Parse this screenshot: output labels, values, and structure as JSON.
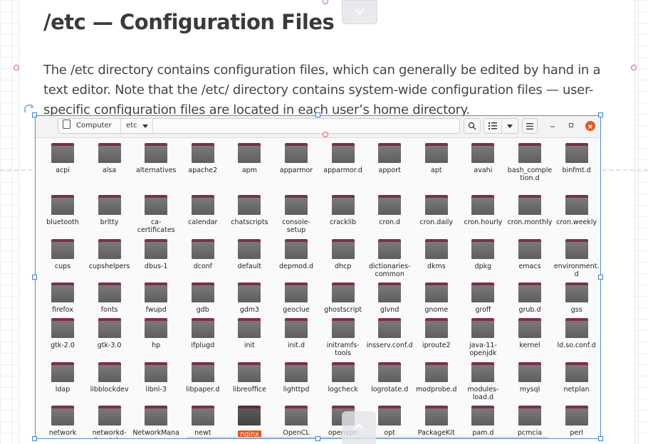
{
  "page": {
    "title": "/etc — Configuration Files",
    "paragraph": "The /etc directory contains configuration files, which can generally be edited by hand in a text editor. Note that the /etc/ directory contains system-wide configuration files — user-specific configuration files are located in each user’s home directory."
  },
  "file_manager": {
    "path": [
      "Computer",
      "etc"
    ],
    "icons": {
      "search": "search-icon",
      "view": "list-view-icon",
      "view_options": "chevron-down-icon",
      "menu": "hamburger-menu-icon",
      "minimize": "minimize-icon",
      "maximize": "maximize-icon",
      "close": "close-icon"
    },
    "accent_color": "#e95420",
    "selected_item": "nginx",
    "rows": [
      [
        "acpi",
        "alsa",
        "alternatives",
        "apache2",
        "apm",
        "apparmor",
        "apparmor.d",
        "apport",
        "apt",
        "avahi",
        "bash_completion.d",
        "binfmt.d"
      ],
      [
        "bluetooth",
        "brltty",
        "ca-certificates",
        "calendar",
        "chatscripts",
        "console-setup",
        "cracklib",
        "cron.d",
        "cron.daily",
        "cron.hourly",
        "cron.monthly",
        "cron.weekly"
      ],
      [
        "cups",
        "cupshelpers",
        "dbus-1",
        "dconf",
        "default",
        "depmod.d",
        "dhcp",
        "dictionaries-common",
        "dkms",
        "dpkg",
        "emacs",
        "environment.d"
      ],
      [
        "firefox",
        "fonts",
        "fwupd",
        "gdb",
        "gdm3",
        "geoclue",
        "ghostscript",
        "glvnd",
        "gnome",
        "groff",
        "grub.d",
        "gss"
      ],
      [
        "gtk-2.0",
        "gtk-3.0",
        "hp",
        "ifplugd",
        "init",
        "init.d",
        "initramfs-tools",
        "insserv.conf.d",
        "iproute2",
        "java-11-openjdk",
        "kernel",
        "ld.so.conf.d"
      ],
      [
        "ldap",
        "libblockdev",
        "libnl-3",
        "libpaper.d",
        "libreoffice",
        "lighttpd",
        "logcheck",
        "logrotate.d",
        "modprobe.d",
        "modules-load.d",
        "mysql",
        "netplan"
      ],
      [
        "network",
        "networkd-dispatcher",
        "NetworkManager",
        "newt",
        "nginx",
        "OpenCL",
        "openvpn",
        "opt",
        "PackageKit",
        "pam.d",
        "pcmcia",
        "perl"
      ]
    ]
  }
}
